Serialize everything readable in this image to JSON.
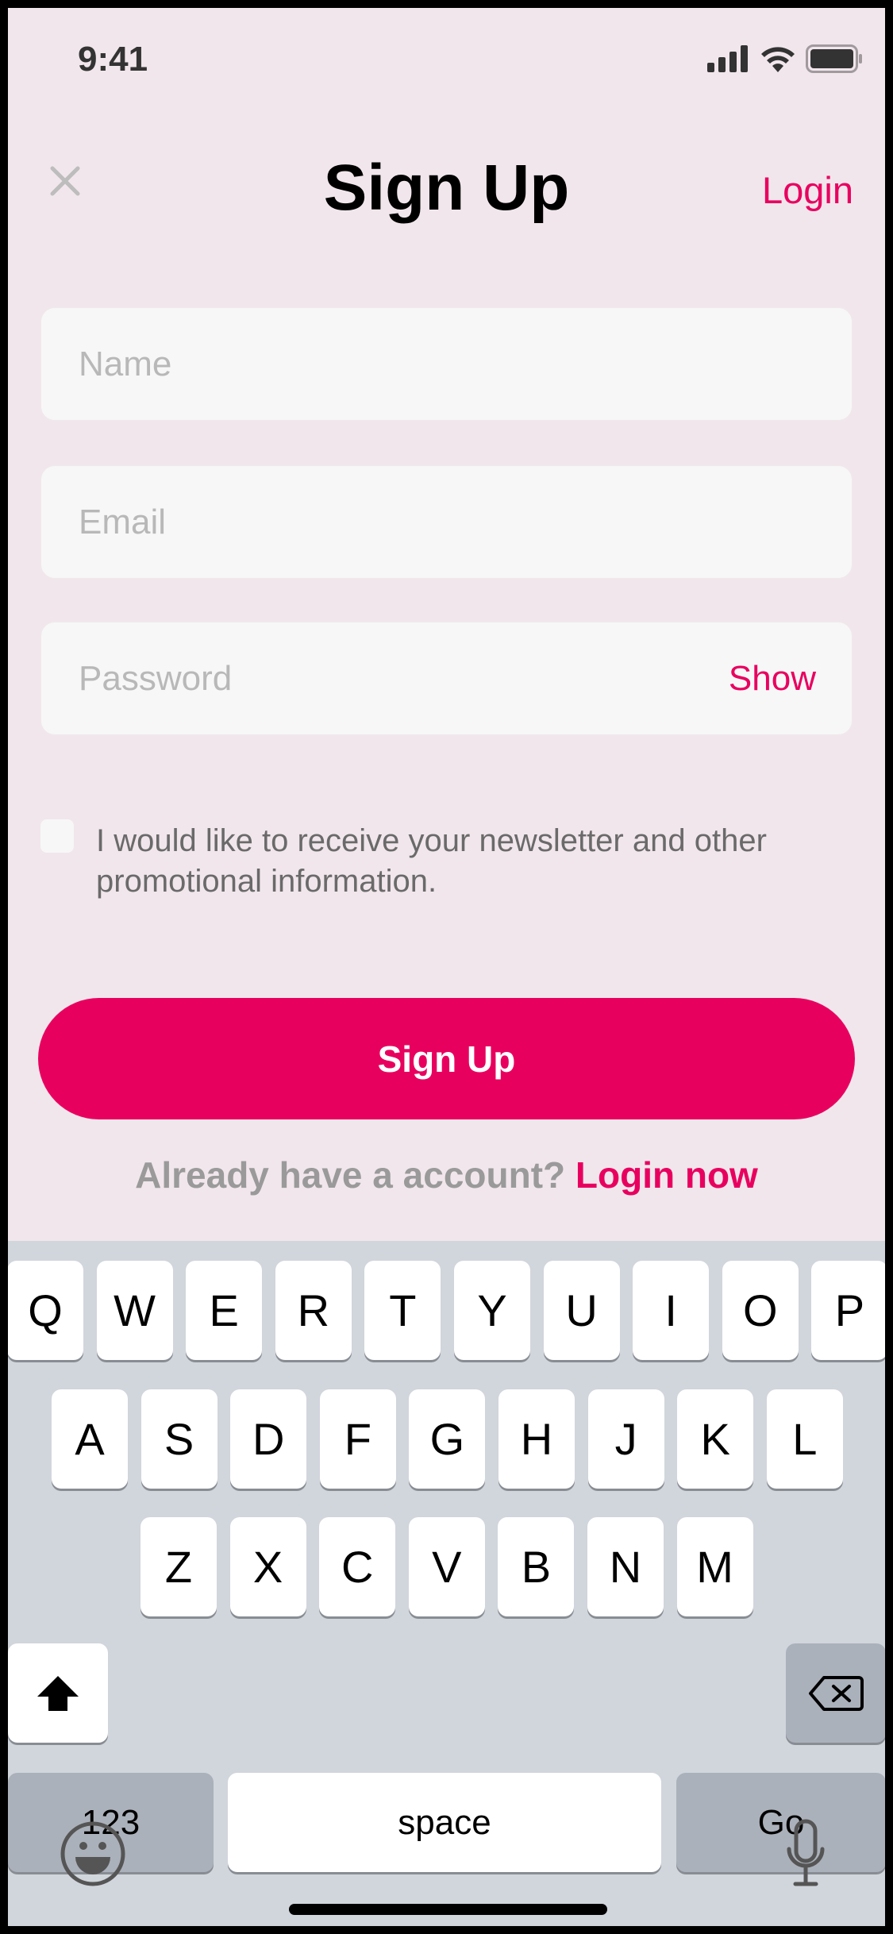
{
  "status_bar": {
    "time": "9:41"
  },
  "header": {
    "title": "Sign Up",
    "login_label": "Login"
  },
  "form": {
    "name_placeholder": "Name",
    "email_placeholder": "Email",
    "password_placeholder": "Password",
    "show_label": "Show",
    "newsletter_label": "I would like to receive your newsletter and other promotional information.",
    "newsletter_checked": false,
    "submit_label": "Sign Up"
  },
  "footer": {
    "prompt": "Already have a account?",
    "link": "Login now"
  },
  "keyboard": {
    "row1": [
      "Q",
      "W",
      "E",
      "R",
      "T",
      "Y",
      "U",
      "I",
      "O",
      "P"
    ],
    "row2": [
      "A",
      "S",
      "D",
      "F",
      "G",
      "H",
      "J",
      "K",
      "L"
    ],
    "row3": [
      "Z",
      "X",
      "C",
      "V",
      "B",
      "N",
      "M"
    ],
    "numbers_label": "123",
    "space_label": "space",
    "go_label": "Go"
  },
  "colors": {
    "accent": "#e8005f",
    "background": "#f1e6ec",
    "field": "#f7f7f7",
    "keyboard": "#d1d5dc"
  }
}
